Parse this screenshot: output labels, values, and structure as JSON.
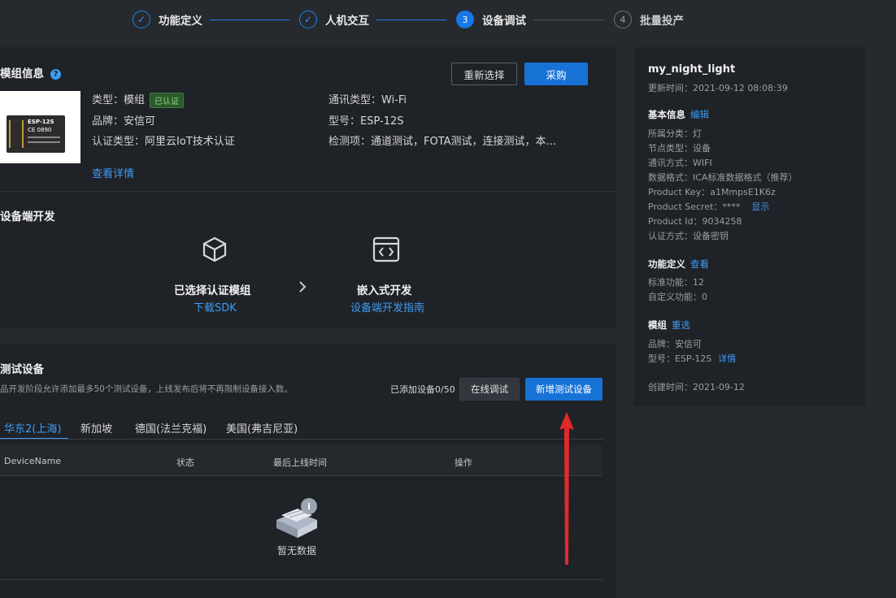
{
  "steps": [
    {
      "num": "✓",
      "label": "功能定义",
      "state": "done"
    },
    {
      "num": "✓",
      "label": "人机交互",
      "state": "done"
    },
    {
      "num": "3",
      "label": "设备调试",
      "state": "active"
    },
    {
      "num": "4",
      "label": "批量投产",
      "state": "todo"
    }
  ],
  "module": {
    "title": "模组信息",
    "reselect": "重新选择",
    "buy": "采购",
    "chip_title": "ESP-12S",
    "chip_sub": "CE 0890",
    "type_label": "类型：",
    "type_value": "模组",
    "certified_badge": "已认证",
    "brand_label": "品牌：",
    "brand_value": "安信可",
    "cert_type_label": "认证类型：",
    "cert_type_value": "阿里云IoT技术认证",
    "comm_label": "通讯类型：",
    "comm_value": "Wi-Fi",
    "model_label": "型号：",
    "model_value": "ESP-12S",
    "check_label": "检测项：",
    "check_value": "通道测试，FOTA测试，连接测试，本...",
    "detail_link": "查看详情"
  },
  "dev": {
    "title": "设备端开发",
    "step1_title": "已选择认证模组",
    "step1_link": "下载SDK",
    "step2_title": "嵌入式开发",
    "step2_link": "设备端开发指南"
  },
  "test": {
    "title": "测试设备",
    "desc": "品开发阶段允许添加最多50个测试设备，上线发布后将不再限制设备接入数。",
    "added": "已添加设备0/50",
    "online_debug": "在线调试",
    "add_device": "新增测试设备",
    "tabs": [
      "华东2(上海)",
      "新加坡",
      "德国(法兰克福)",
      "美国(弗吉尼亚)"
    ],
    "columns": [
      "DeviceName",
      "状态",
      "最后上线时间",
      "操作"
    ],
    "empty": "暂无数据"
  },
  "sidebar": {
    "product_name": "my_night_light",
    "update_time": "更新时间：2021-09-12 08:08:39",
    "basic_title": "基本信息",
    "basic_edit": "编辑",
    "category": "所属分类：灯",
    "node_type": "节点类型：设备",
    "comm_mode": "通讯方式：WIFI",
    "data_format": "数据格式：ICA标准数据格式（推荐）",
    "product_key": "Product Key：a1MmpsE1K6z",
    "product_secret": "Product Secret：****",
    "show_link": "显示",
    "product_id": "Product Id：9034258",
    "auth_mode": "认证方式：设备密钥",
    "func_title": "功能定义",
    "func_view": "查看",
    "std_func": "标准功能：12",
    "custom_func": "自定义功能：0",
    "module_title": "模组",
    "module_reselect": "重选",
    "module_brand": "品牌：安信可",
    "module_model": "型号：ESP-12S",
    "module_detail": "详情",
    "created": "创建时间：2021-09-12"
  },
  "colors": {
    "accent": "#1772d6",
    "link": "#3f9cf5",
    "arrow": "#e02a2a"
  }
}
